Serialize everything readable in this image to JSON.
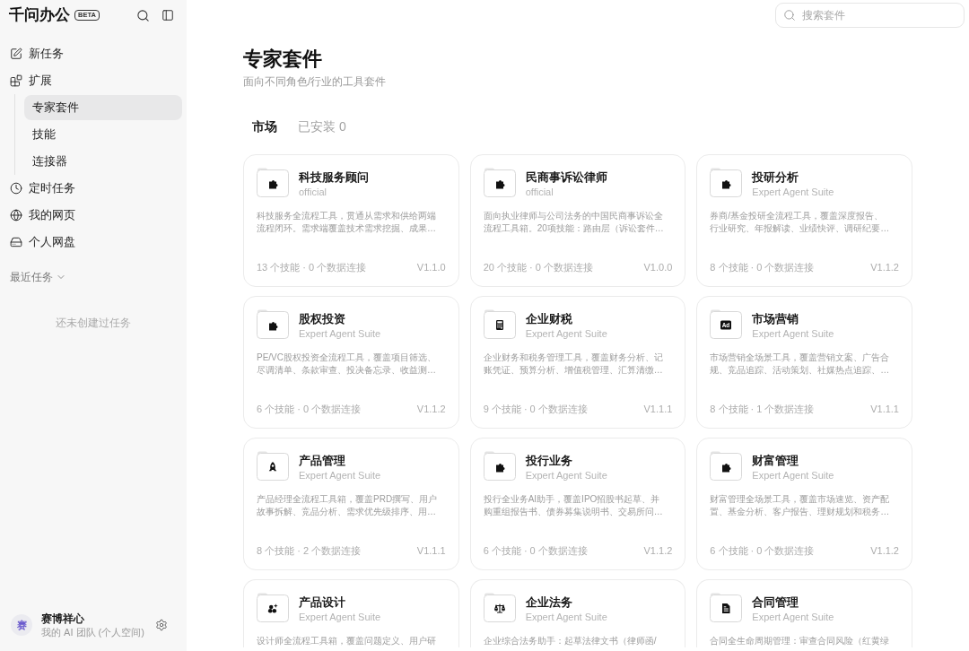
{
  "sidebar": {
    "brand": "千问办公",
    "badge": "BETA",
    "nav": [
      {
        "label": "新任务",
        "kind": "edit",
        "selected": false
      },
      {
        "label": "扩展",
        "kind": "blocks",
        "selected": false,
        "children": [
          {
            "label": "专家套件",
            "selected": true
          },
          {
            "label": "技能",
            "selected": false
          },
          {
            "label": "连接器",
            "selected": false
          }
        ]
      },
      {
        "label": "定时任务",
        "kind": "clock",
        "selected": false
      },
      {
        "label": "我的网页",
        "kind": "globe",
        "selected": false
      },
      {
        "label": "个人网盘",
        "kind": "drive",
        "selected": false
      }
    ],
    "recent": {
      "label": "最近任务",
      "expanded": true,
      "empty_text": "还未创建过任务"
    },
    "user": {
      "avatar": "赛",
      "name": "赛博祥心",
      "team": "我的 AI 团队 (个人空间)"
    }
  },
  "search": {
    "placeholder": "搜索套件"
  },
  "page": {
    "title": "专家套件",
    "subtitle": "面向不同角色/行业的工具套件"
  },
  "tabs": [
    {
      "label": "市场",
      "selected": true
    },
    {
      "label": "已安装 0",
      "selected": false
    }
  ],
  "suites": [
    {
      "kind": "puzzle",
      "name": "科技服务顾问",
      "source": "official",
      "description": [
        "科技服务全流程工具，贯通从需求和供给两端",
        "流程闭环。需求端覆盖技术需求挖掘、成果…"
      ],
      "stats": "13 个技能 · 0 个数据连接",
      "version": "V1.1.0"
    },
    {
      "kind": "puzzle",
      "name": "民商事诉讼律师",
      "source": "official",
      "description": [
        "面向执业律师与公司法务的中国民商事诉讼全",
        "流程工具箱。20项技能：路由层（诉讼套件…"
      ],
      "stats": "20 个技能 · 0 个数据连接",
      "version": "V1.0.0"
    },
    {
      "kind": "puzzle",
      "name": "投研分析",
      "source": "Expert Agent Suite",
      "description": [
        "券商/基金投研全流程工具，覆盖深度报告、",
        "行业研究、年报解读、业绩快评、调研纪要…"
      ],
      "stats": "8 个技能 · 0 个数据连接",
      "version": "V1.1.2"
    },
    {
      "kind": "puzzle",
      "name": "股权投资",
      "source": "Expert Agent Suite",
      "description": [
        "PE/VC股权投资全流程工具，覆盖项目筛选、",
        "尽调清单、条款审查、投决备忘录、收益测…"
      ],
      "stats": "6 个技能 · 0 个数据连接",
      "version": "V1.1.2"
    },
    {
      "kind": "calculator",
      "name": "企业财税",
      "source": "Expert Agent Suite",
      "description": [
        "企业财务和税务管理工具，覆盖财务分析、记",
        "账凭证、预算分析、增值税管理、汇算清缴…"
      ],
      "stats": "9 个技能 · 0 个数据连接",
      "version": "V1.1.1"
    },
    {
      "kind": "ad",
      "icon_text": "Ad",
      "name": "市场营销",
      "source": "Expert Agent Suite",
      "description": [
        "市场营销全场景工具，覆盖营销文案、广告合",
        "规、竞品追踪、活动策划、社媒热点追踪、…"
      ],
      "stats": "8 个技能 · 1 个数据连接",
      "version": "V1.1.1"
    },
    {
      "kind": "rocket",
      "name": "产品管理",
      "source": "Expert Agent Suite",
      "description": [
        "产品经理全流程工具箱，覆盖PRD撰写、用户",
        "故事拆解、竞品分析、需求优先级排序、用…"
      ],
      "stats": "8 个技能 · 2 个数据连接",
      "version": "V1.1.1"
    },
    {
      "kind": "puzzle",
      "name": "投行业务",
      "source": "Expert Agent Suite",
      "description": [
        "投行全业务AI助手，覆盖IPO招股书起草、并",
        "购重组报告书、债券募集说明书、交易所问…"
      ],
      "stats": "6 个技能 · 0 个数据连接",
      "version": "V1.1.2"
    },
    {
      "kind": "puzzle",
      "name": "财富管理",
      "source": "Expert Agent Suite",
      "description": [
        "财富管理全场景工具，覆盖市场速览、资产配",
        "置、基金分析、客户报告、理财规划和税务…"
      ],
      "stats": "6 个技能 · 0 个数据连接",
      "version": "V1.1.2"
    },
    {
      "kind": "dots",
      "name": "产品设计",
      "source": "Expert Agent Suite",
      "description": [
        "设计师全流程工具箱，覆盖问题定义、用户研"
      ]
    },
    {
      "kind": "scale",
      "name": "企业法务",
      "source": "Expert Agent Suite",
      "description": [
        "企业综合法务助手：起草法律文书（律师函/"
      ]
    },
    {
      "kind": "document",
      "name": "合同管理",
      "source": "Expert Agent Suite",
      "description": [
        "合同全生命周期管理：审查合同风险（红黄绿"
      ]
    }
  ]
}
